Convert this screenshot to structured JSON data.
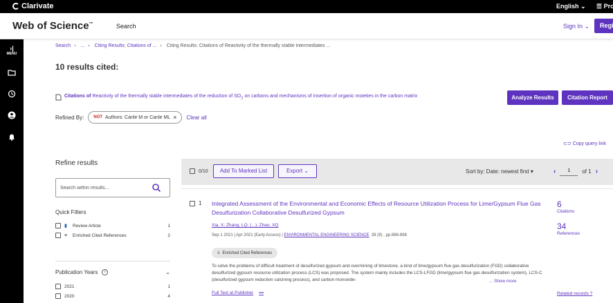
{
  "topbar": {
    "brand": "Clarivate",
    "language": "English",
    "products": "Products"
  },
  "header": {
    "product_name": "Web of Science",
    "trademark": "™",
    "search_link": "Search",
    "sign_in": "Sign In",
    "register": "Register"
  },
  "rail": {
    "menu_label": "MENU"
  },
  "breadcrumb": {
    "items": [
      "Search",
      "...",
      "Citing Results: Citations of ...",
      "Citing Results: Citations of Reactivity of the thermally stable intermediates ..."
    ]
  },
  "results_title": "10 results cited:",
  "citations_of": {
    "prefix": "Citations of",
    "text": "Reactivity of the thermally stable intermediates of the reduction of SO",
    "subscript": "2",
    "suffix": "on carbons and mechanisms of insertion of organic moieties in the carbon matrix"
  },
  "buttons": {
    "analyze": "Analyze Results",
    "citation_report": "Citation Report"
  },
  "refined": {
    "label": "Refined By:",
    "not_tag": "NOT",
    "pill_text": "Authors: Canle M or Canle ML",
    "clear_all": "Clear all"
  },
  "copy_query": "Copy query link",
  "sidebar": {
    "title": "Refine results",
    "search_placeholder": "Search within results...",
    "quick_filters_title": "Quick Filters",
    "quick_filters": [
      {
        "label": "Review Article",
        "count": "1"
      },
      {
        "label": "Enriched Cited References",
        "count": "2"
      }
    ],
    "publication_years_title": "Publication Years",
    "years": [
      {
        "label": "2021",
        "count": "1"
      },
      {
        "label": "2020",
        "count": "4"
      }
    ]
  },
  "toolbar": {
    "selected": "0/10",
    "add_to_marked": "Add To Marked List",
    "export": "Export",
    "sort_by": "Sort by: Date: newest first",
    "page_value": "1",
    "page_of": "of 1"
  },
  "record": {
    "number": "1",
    "title": "Integrated Assessment of the Environmental and Economic Effects of Resource Utilization Process for Lime/Gypsum Flue Gas Desulfurization Collaborative Desulfurized Gypsum",
    "authors": "Xia, X; Zhang, LQ; (...); Zhao, XQ",
    "meta_dates": "Sep 1 2021 | Apr 2021 (Early Access) |",
    "journal": "ENVIRONMENTAL ENGINEERING SCIENCE",
    "volume_pages": "38 (9) , pp.886-898",
    "enriched_label": "Enriched Cited References",
    "abstract": "To solve the problems of difficult treatment of desulfurized gypsum and overmining of limestone, a kind of lime/gypsum flue gas desulfurization (FGD) collaborative desulfurized gypsum resource utilization process (LCS) was proposed. The system mainly includes the LCS-LFGD (lime/gypsum flue gas desulfurization system), LCS-C (desulfurized gypsum reduction calcining process), and carbon monoxide-",
    "show_more": "Show more",
    "full_text": "Full Text at Publisher",
    "citations_count": "6",
    "citations_label": "Citations",
    "references_count": "34",
    "references_label": "References",
    "related_records": "Related records"
  }
}
